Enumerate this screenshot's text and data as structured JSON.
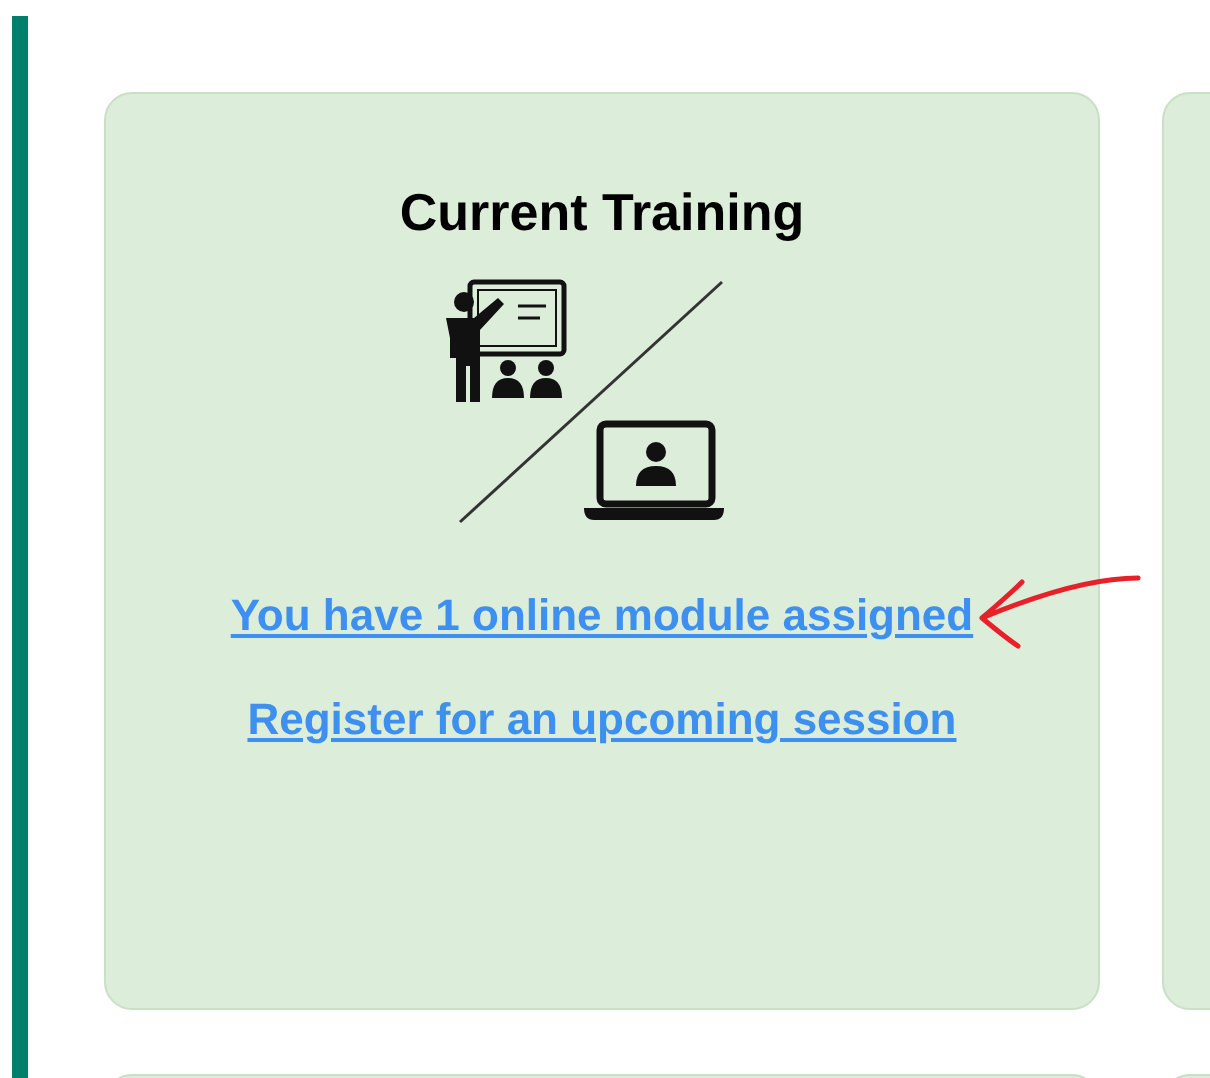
{
  "card": {
    "title": "Current Training",
    "links": [
      {
        "label": "You have 1 online module assigned",
        "annotated": true
      },
      {
        "label": "Register for an upcoming session",
        "annotated": false
      }
    ]
  }
}
